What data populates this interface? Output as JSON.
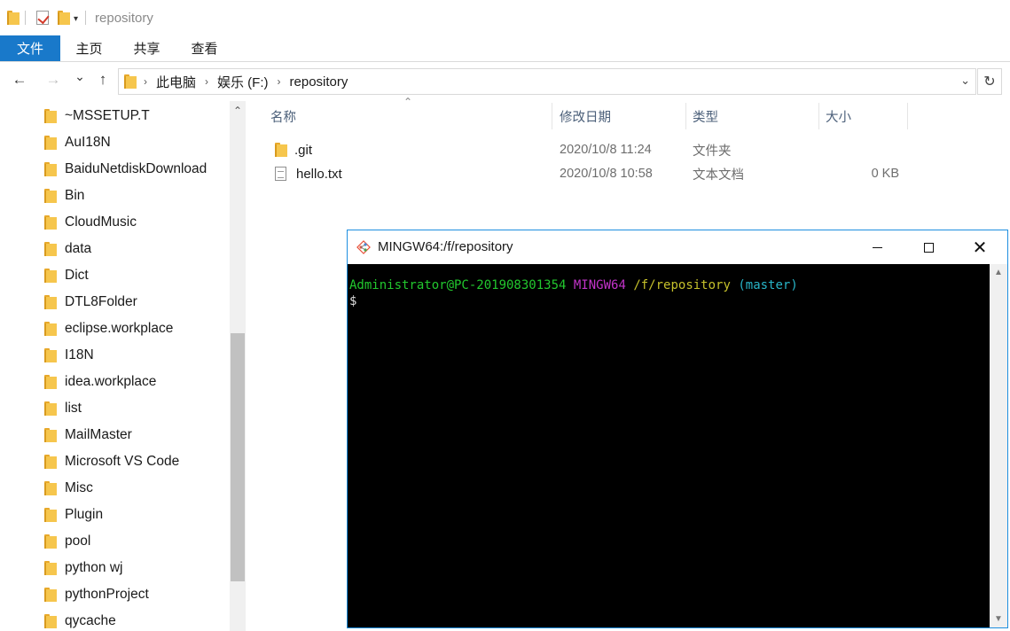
{
  "titlebar": {
    "title": "repository",
    "quick_access_arrow": "▾"
  },
  "ribbon": {
    "tabs": [
      {
        "label": "文件",
        "active": true
      },
      {
        "label": "主页"
      },
      {
        "label": "共享"
      },
      {
        "label": "查看"
      }
    ]
  },
  "navigation": {
    "back": "←",
    "forward": "→",
    "recent": "⌄",
    "up": "↑",
    "breadcrumbs": [
      "此电脑",
      "娱乐 (F:)",
      "repository"
    ],
    "refresh": "↻"
  },
  "nav_pane": {
    "items": [
      "~MSSETUP.T",
      "AuI18N",
      "BaiduNetdiskDownload",
      "Bin",
      "CloudMusic",
      "data",
      "Dict",
      "DTL8Folder",
      "eclipse.workplace",
      "I18N",
      "idea.workplace",
      "list",
      "MailMaster",
      "Microsoft VS Code",
      "Misc",
      "Plugin",
      "pool",
      "python wj",
      "pythonProject",
      "qycache"
    ]
  },
  "file_list": {
    "columns": [
      "名称",
      "修改日期",
      "类型",
      "大小"
    ],
    "rows": [
      {
        "name": ".git",
        "modified": "2020/10/8 11:24",
        "type": "文件夹",
        "size": "",
        "icon": "folder-icon"
      },
      {
        "name": "hello.txt",
        "modified": "2020/10/8 10:58",
        "type": "文本文档",
        "size": "0 KB",
        "icon": "text-file-icon"
      }
    ]
  },
  "terminal": {
    "title": "MINGW64:/f/repository",
    "prompt": {
      "user_host": "Administrator@PC-201908301354",
      "system": "MINGW64",
      "path": "/f/repository",
      "branch": "(master)",
      "symbol": "$"
    },
    "colors": {
      "user_host": "#22c72e",
      "system": "#c233c9",
      "path": "#c6c12b",
      "branch": "#28b5c8"
    }
  },
  "colors": {
    "file_tab_bg": "#1979ca",
    "window_border": "#1e8fe0",
    "folder": "#f6c64d"
  }
}
